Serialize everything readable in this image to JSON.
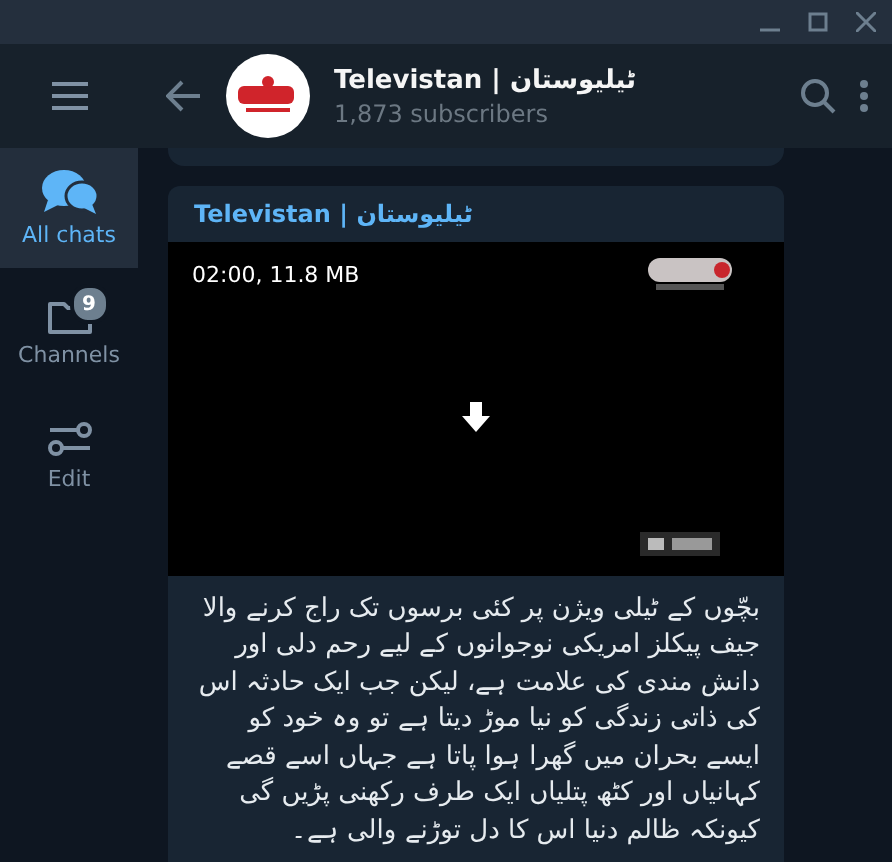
{
  "sidebar": {
    "items": [
      {
        "label": "All chats",
        "selected": true
      },
      {
        "label": "Channels",
        "selected": false,
        "badge": "9"
      },
      {
        "label": "Edit",
        "selected": false
      }
    ]
  },
  "header": {
    "title": "Televistan | ٹیلیوستان",
    "subtitle": "1,873 subscribers"
  },
  "message": {
    "author": "Televistan | ٹیلیوستان",
    "video": {
      "kind": "picture",
      "info": "02:00, 11.8 MB"
    },
    "text": "بچّوں کے ٹیلی ویژن پر کئی برسوں تک راج کرنے والا جیف پیکلز امریکی نوجوانوں کے لیے رحم دلی اور دانش مندی کی علامت ہے، لیکن جب ایک حادثہ اس کی ذاتی زندگی کو نیا موڑ دیتا ہے تو وہ خود کو ایسے بحران میں گھرا ہوا پاتا ہے جہاں اسے قصے کہانیاں اور کٹھ پتلیاں ایک طرف رکھنی پڑیں گی کیونکہ ظالم دنیا اس کا دل توڑنے والی ہے۔"
  }
}
